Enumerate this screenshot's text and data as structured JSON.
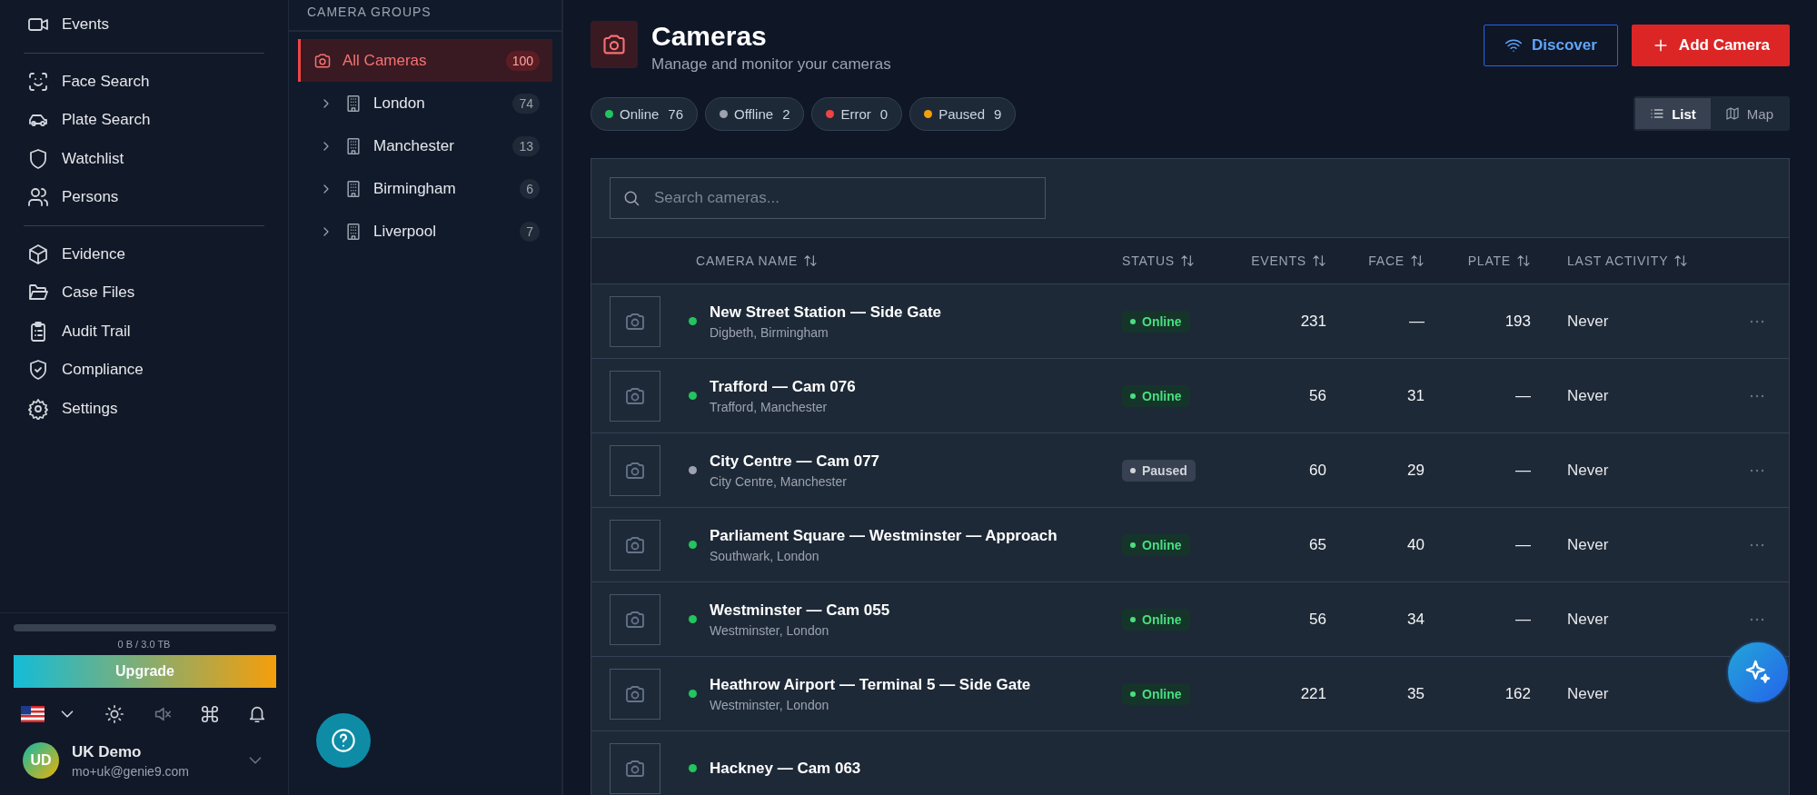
{
  "sidebar": {
    "sections": [
      {
        "items": [
          {
            "label": "Events"
          }
        ]
      },
      {
        "items": [
          {
            "label": "Face Search"
          },
          {
            "label": "Plate Search"
          },
          {
            "label": "Watchlist"
          },
          {
            "label": "Persons"
          }
        ]
      },
      {
        "items": [
          {
            "label": "Evidence"
          },
          {
            "label": "Case Files"
          },
          {
            "label": "Audit Trail"
          },
          {
            "label": "Compliance"
          },
          {
            "label": "Settings"
          }
        ]
      }
    ],
    "storage": {
      "text": "0 B / 3.0 TB"
    },
    "upgrade_button": "Upgrade",
    "user": {
      "initials": "UD",
      "name": "UK Demo",
      "email": "mo+uk@genie9.com"
    }
  },
  "camera_groups": {
    "title": "CAMERA GROUPS",
    "items": [
      {
        "kind": "all",
        "label": "All Cameras",
        "count": "100",
        "selected": true
      },
      {
        "kind": "city",
        "label": "London",
        "count": "74",
        "selected": false
      },
      {
        "kind": "city",
        "label": "Manchester",
        "count": "13",
        "selected": false
      },
      {
        "kind": "city",
        "label": "Birmingham",
        "count": "6",
        "selected": false
      },
      {
        "kind": "city",
        "label": "Liverpool",
        "count": "7",
        "selected": false
      }
    ]
  },
  "header": {
    "title": "Cameras",
    "subtitle": "Manage and monitor your cameras",
    "discover_button": "Discover",
    "add_button": "Add Camera"
  },
  "status_filters": [
    {
      "label": "Online",
      "count": "76",
      "color": "#22c55e"
    },
    {
      "label": "Offline",
      "count": "2",
      "color": "#9ca3af"
    },
    {
      "label": "Error",
      "count": "0",
      "color": "#ef4444"
    },
    {
      "label": "Paused",
      "count": "9",
      "color": "#f59e0b"
    }
  ],
  "view_toggle": [
    {
      "label": "List",
      "selected": true
    },
    {
      "label": "Map",
      "selected": false
    }
  ],
  "search": {
    "placeholder": "Search cameras..."
  },
  "table": {
    "columns": [
      {
        "label": "CAMERA NAME"
      },
      {
        "label": "STATUS"
      },
      {
        "label": "EVENTS"
      },
      {
        "label": "FACE"
      },
      {
        "label": "PLATE"
      },
      {
        "label": "LAST ACTIVITY"
      }
    ],
    "rows": [
      {
        "name": "New Street Station — Side Gate",
        "location": "Digbeth, Birmingham",
        "status": {
          "kind": "online",
          "label": "Online"
        },
        "events": "231",
        "face": "—",
        "plate": "193",
        "last_activity": "Never"
      },
      {
        "name": "Trafford — Cam 076",
        "location": "Trafford, Manchester",
        "status": {
          "kind": "online",
          "label": "Online"
        },
        "events": "56",
        "face": "31",
        "plate": "—",
        "last_activity": "Never"
      },
      {
        "name": "City Centre — Cam 077",
        "location": "City Centre, Manchester",
        "status": {
          "kind": "paused",
          "label": "Paused"
        },
        "events": "60",
        "face": "29",
        "plate": "—",
        "last_activity": "Never"
      },
      {
        "name": "Parliament Square — Westminster — Approach",
        "location": "Southwark, London",
        "status": {
          "kind": "online",
          "label": "Online"
        },
        "events": "65",
        "face": "40",
        "plate": "—",
        "last_activity": "Never"
      },
      {
        "name": "Westminster — Cam 055",
        "location": "Westminster, London",
        "status": {
          "kind": "online",
          "label": "Online"
        },
        "events": "56",
        "face": "34",
        "plate": "—",
        "last_activity": "Never"
      },
      {
        "name": "Heathrow Airport — Terminal 5 — Side Gate",
        "location": "Westminster, London",
        "status": {
          "kind": "online",
          "label": "Online"
        },
        "events": "221",
        "face": "35",
        "plate": "162",
        "last_activity": "Never"
      },
      {
        "name": "Hackney — Cam 063",
        "status": {
          "kind": "online"
        }
      }
    ]
  }
}
